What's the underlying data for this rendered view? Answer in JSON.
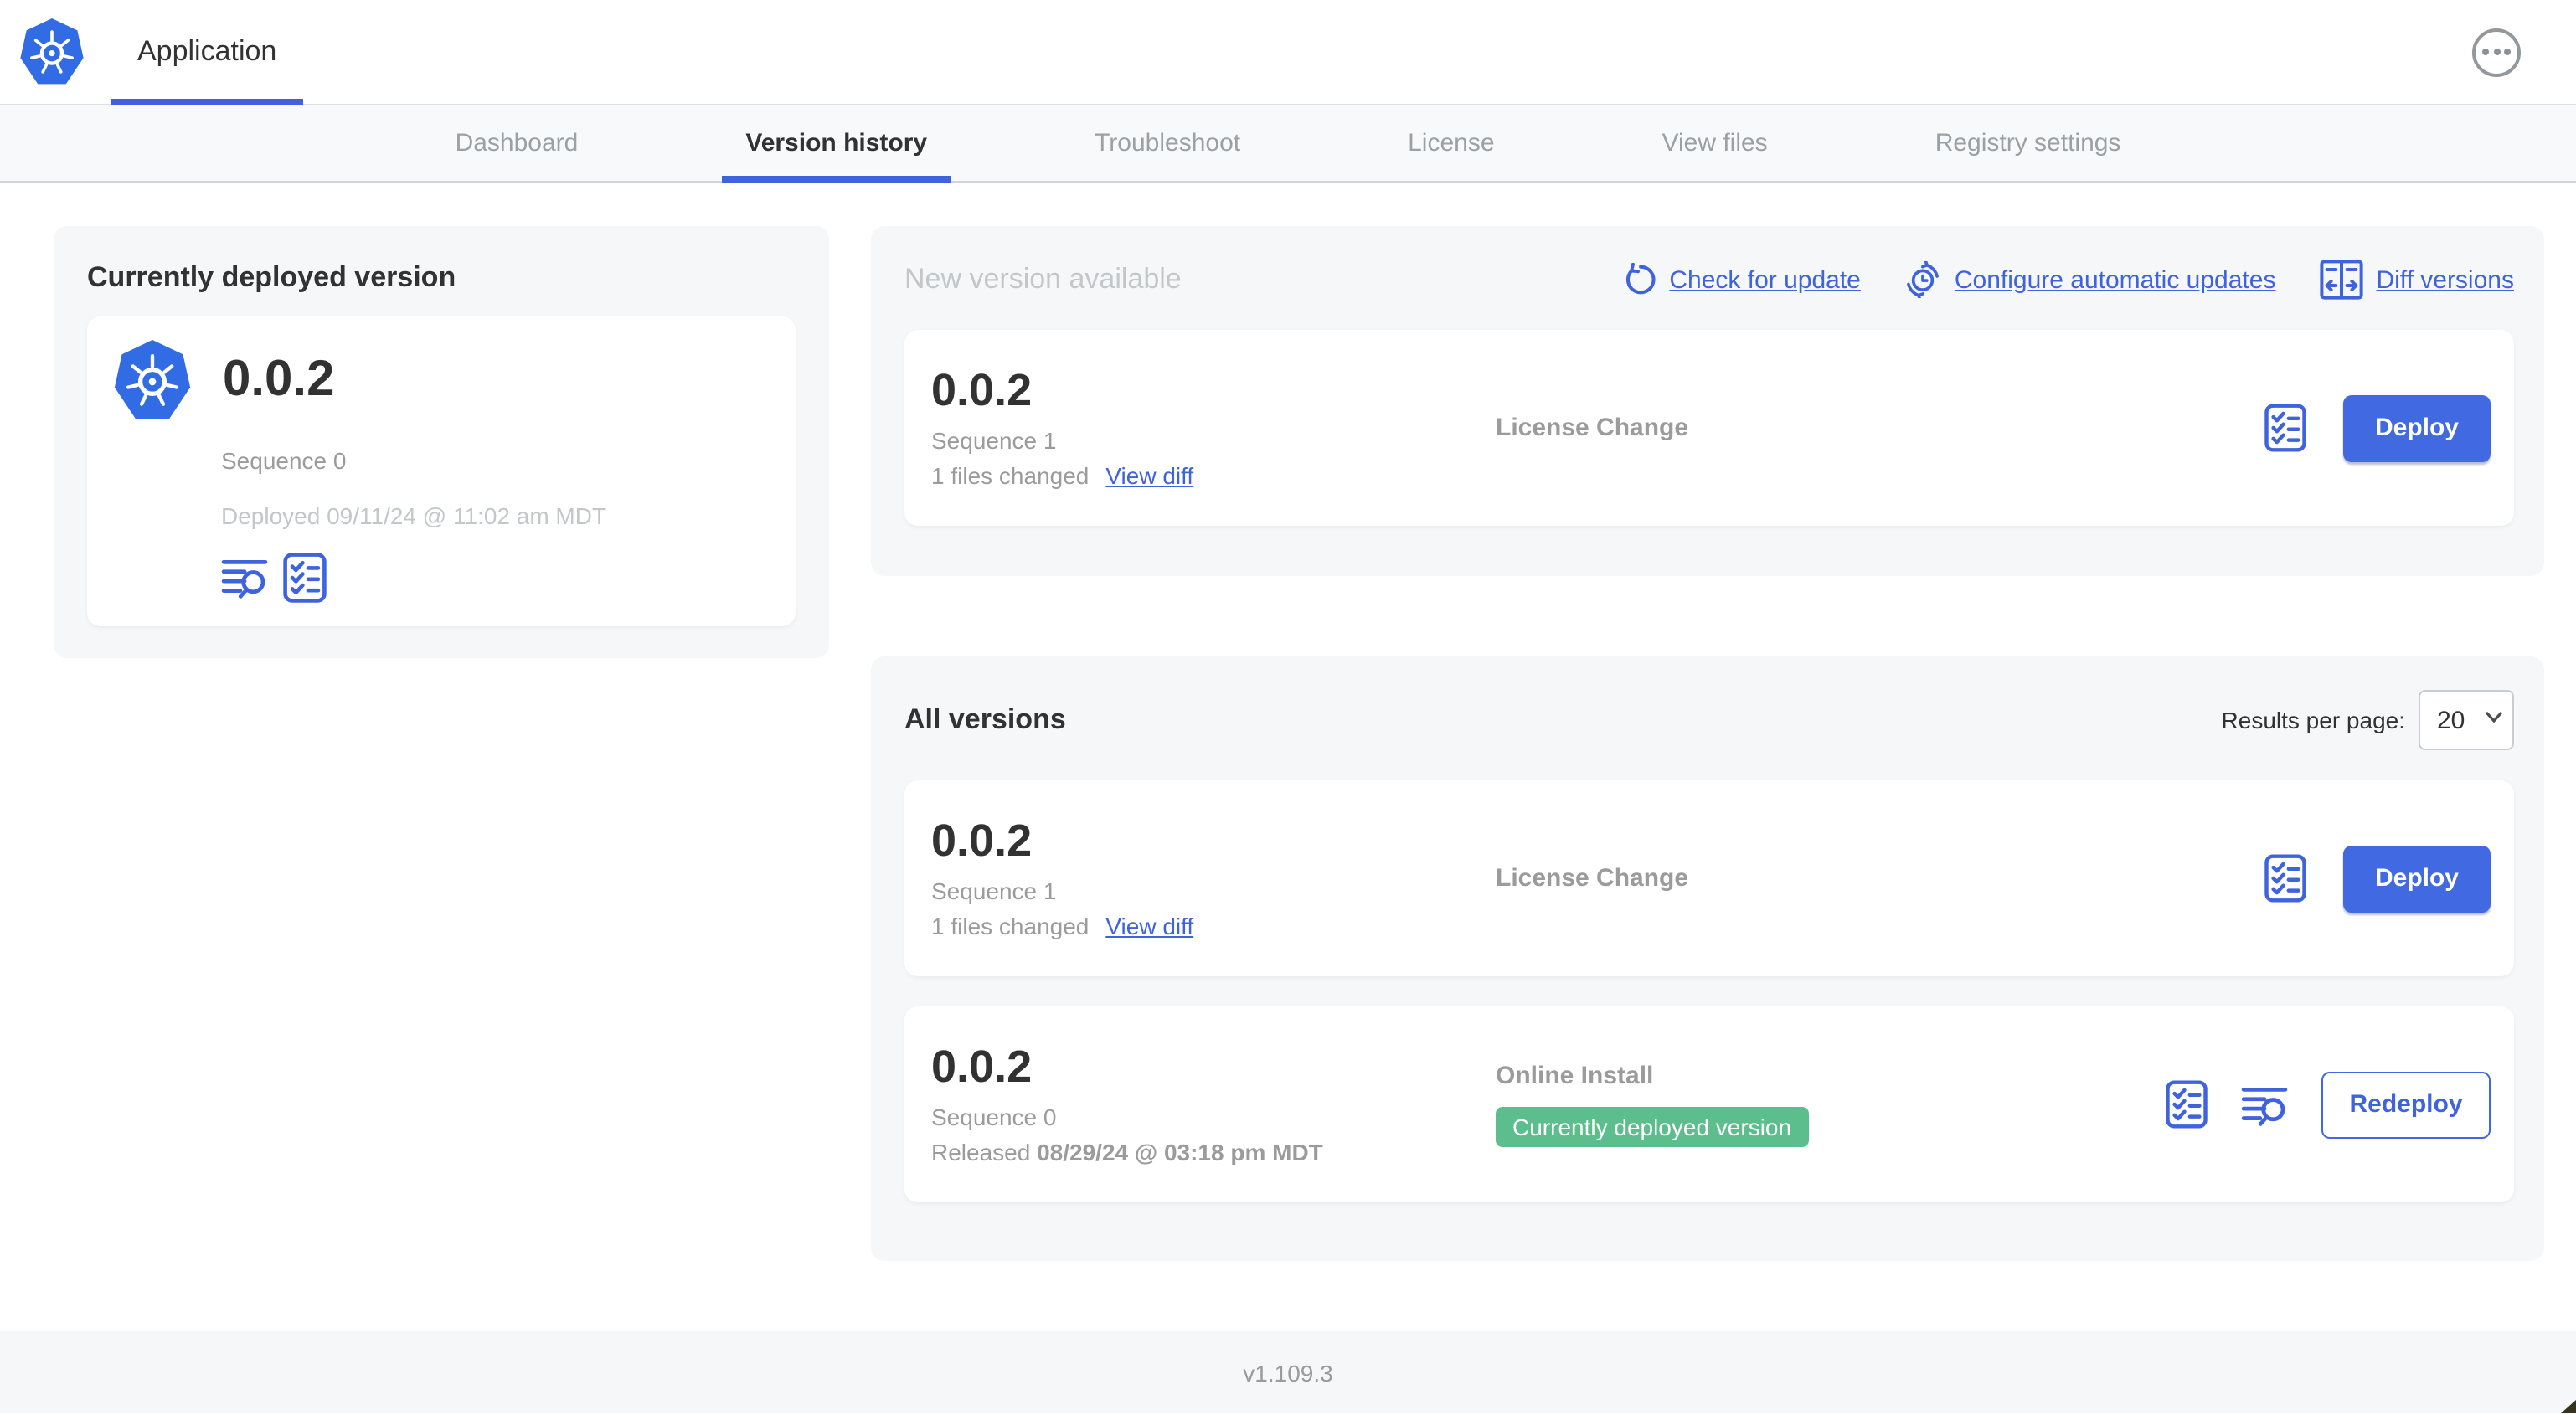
{
  "header": {
    "app_tab": "Application"
  },
  "nav": {
    "tabs": [
      {
        "label": "Dashboard",
        "active": false
      },
      {
        "label": "Version history",
        "active": true
      },
      {
        "label": "Troubleshoot",
        "active": false
      },
      {
        "label": "License",
        "active": false
      },
      {
        "label": "View files",
        "active": false
      },
      {
        "label": "Registry settings",
        "active": false
      }
    ]
  },
  "currently_deployed": {
    "title": "Currently deployed version",
    "version": "0.0.2",
    "sequence": "Sequence 0",
    "deployed_at": "Deployed 09/11/24 @ 11:02 am MDT"
  },
  "new_version": {
    "title": "New version available",
    "actions": {
      "check_for_update": "Check for update",
      "configure_automatic_updates": "Configure automatic updates",
      "diff_versions": "Diff versions"
    },
    "card": {
      "version": "0.0.2",
      "sequence": "Sequence 1",
      "files_changed": "1 files changed",
      "view_diff": "View diff",
      "source": "License Change",
      "deploy_label": "Deploy"
    }
  },
  "all_versions": {
    "title": "All versions",
    "results_per_page_label": "Results per page:",
    "results_per_page_value": "20",
    "rows": [
      {
        "version": "0.0.2",
        "sequence": "Sequence 1",
        "files_changed": "1 files changed",
        "view_diff": "View diff",
        "source": "License Change",
        "button_label": "Deploy"
      },
      {
        "version": "0.0.2",
        "sequence": "Sequence 0",
        "released_label": "Released",
        "released_date": "08/29/24 @ 03:18 pm MDT",
        "source": "Online Install",
        "badge": "Currently deployed version",
        "button_label": "Redeploy"
      }
    ]
  },
  "footer": {
    "app_manager_version": "v1.109.3"
  },
  "icons": {
    "kubernetes-logo": "helm wheel in blue heptagon",
    "ellipsis-icon": "⋯",
    "refresh-icon": "↺",
    "schedule-icon": "clock with recurring arrows",
    "diff-icon": "split compare box ⇄",
    "checklist-icon": "bordered list with checkmarks",
    "logs-icon": "text lines with magnifier",
    "chevron-down-icon": "v"
  },
  "colors": {
    "accent_blue": "#3E63DD",
    "button_blue": "#4169E1",
    "logo_blue": "#326CE5",
    "badge_green": "#5CBE8D",
    "muted_gray": "#9B9B9B",
    "light_gray": "#C3C7CA",
    "panel_bg": "#F5F7F9"
  }
}
